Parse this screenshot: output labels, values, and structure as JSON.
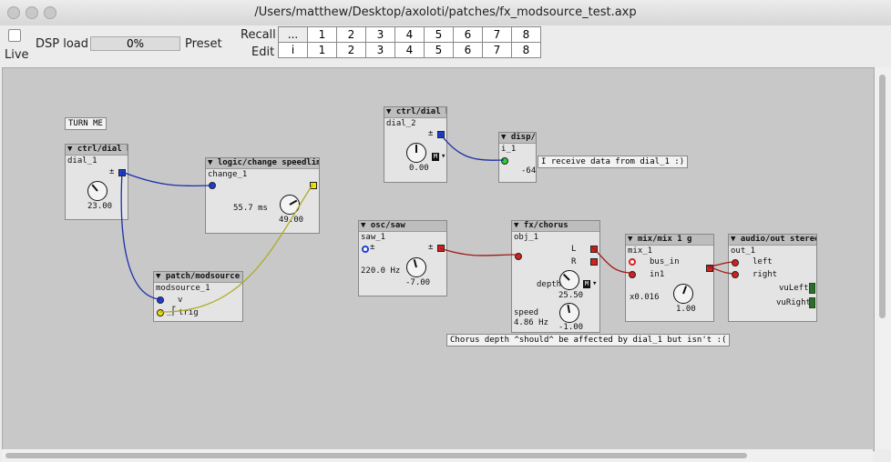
{
  "window": {
    "title": "/Users/matthew/Desktop/axoloti/patches/fx_modsource_test.axp"
  },
  "toolbar": {
    "live_label": "Live",
    "dsp_label": "DSP load",
    "dsp_value": "0%",
    "preset_label": "Preset",
    "recall_label": "Recall",
    "edit_label": "Edit",
    "recall_first": "...",
    "edit_first": "i",
    "presets": [
      "1",
      "2",
      "3",
      "4",
      "5",
      "6",
      "7",
      "8"
    ]
  },
  "patch": {
    "note_turn_me": "TURN ME",
    "note_receive": "I receive data from dial_1 :)",
    "note_chorus": "Chorus depth ^should^ be affected by dial_1 but isn't :(",
    "dial1": {
      "type": "ctrl/dial b",
      "name": "dial_1",
      "value": "23.00",
      "pm": "±"
    },
    "dial2": {
      "type": "ctrl/dial b",
      "name": "dial_2",
      "value": "0.00",
      "pm": "±",
      "m": "M"
    },
    "change1": {
      "type": "logic/change speedlim",
      "name": "change_1",
      "time": "55.7 ms",
      "value": "49.00"
    },
    "modsource1": {
      "type": "patch/modsource",
      "name": "modsource_1",
      "in_v": "v",
      "in_trig": "trig"
    },
    "disp1": {
      "type": "disp/i",
      "name": "i_1",
      "value": "-64"
    },
    "saw1": {
      "type": "osc/saw",
      "name": "saw_1",
      "pm": "±",
      "freq": "220.0 Hz",
      "value": "-7.00"
    },
    "chorus": {
      "type": "fx/chorus",
      "name": "obj_1",
      "out_l": "L",
      "out_r": "R",
      "depth_label": "depth",
      "depth_value": "25.50",
      "m": "M",
      "speed_label": "speed",
      "speed_value": "4.86 Hz",
      "speed_knob": "-1.00"
    },
    "mix1": {
      "type": "mix/mix 1 g",
      "name": "mix_1",
      "in_bus": "bus_in",
      "in_in1": "in1",
      "gain_label": "x0.016",
      "value": "1.00"
    },
    "out1": {
      "type": "audio/out stereo",
      "name": "out_1",
      "in_left": "left",
      "in_right": "right",
      "vu_left": "vuLeft",
      "vu_right": "vuRight"
    }
  },
  "colors": {
    "wire_blue": "#1c2ea6",
    "wire_yellow": "#aeab28",
    "wire_red": "#a01818",
    "pin_blue": "#1d3fd6",
    "pin_yellow": "#f0e100",
    "pin_red": "#d42020",
    "pin_green": "#27d427"
  }
}
